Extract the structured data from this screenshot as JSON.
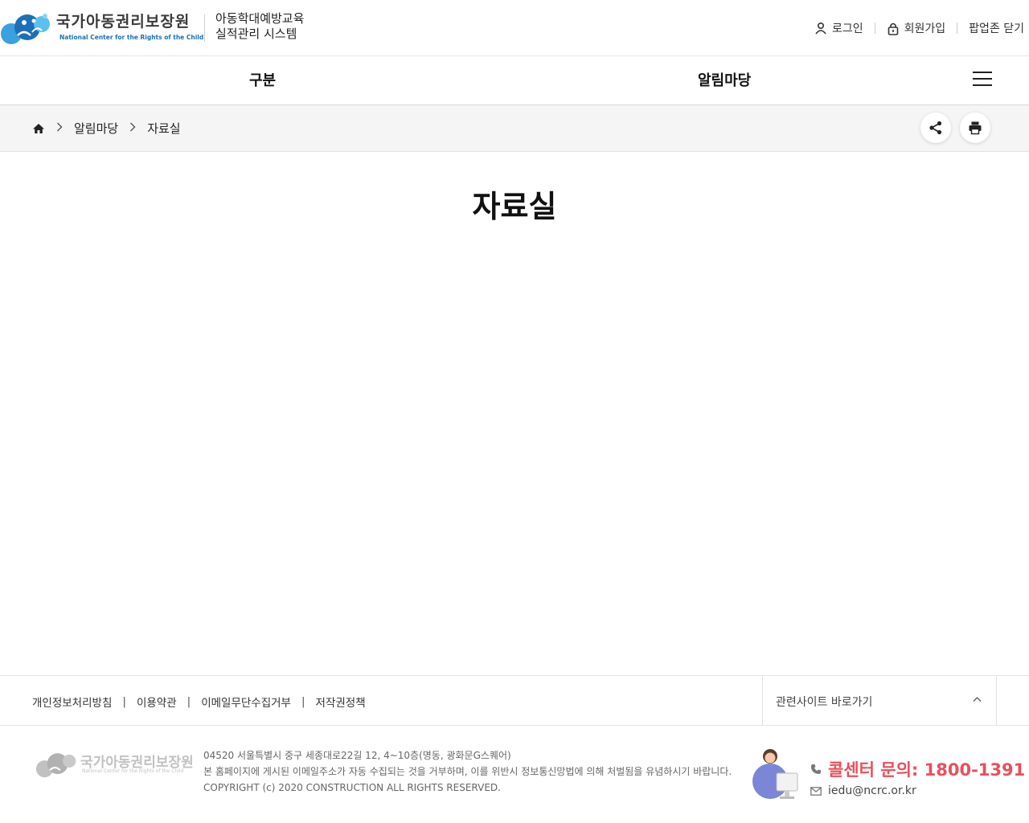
{
  "header": {
    "logo_ko": "국가아동권리보장원",
    "logo_en": "National Center for the Rights of the Child",
    "system_title_line1": "아동학대예방교육",
    "system_title_line2": "실적관리 시스템",
    "util": {
      "login": "로그인",
      "signup": "회원가입",
      "close_popup": "팝업존 닫기"
    }
  },
  "gnb": {
    "items": [
      "구분",
      "알림마당"
    ]
  },
  "breadcrumb": {
    "level1": "알림마당",
    "level2": "자료실"
  },
  "page": {
    "title": "자료실"
  },
  "footer": {
    "links": [
      "개인정보처리방침",
      "이용약관",
      "이메일무단수집거부",
      "저작권정책"
    ],
    "separator": "|",
    "related_sites": "관련사이트 바로가기",
    "logo_ko": "국가아동권리보장원",
    "logo_en": "National Center for the Rights of the Child",
    "address": "04520 서울특별시 중구 세종대로22길 12, 4~10층(명동, 광화문G스퀘어)",
    "notice": "본 홈페이지에 게시된 이메일주소가 자동 수집되는 것을 거부하며, 이를 위반시 정보통신망법에 의해 처벌됨을 유념하시기 바랍니다.",
    "copyright": "COPYRIGHT (c) 2020 CONSTRUCTION ALL RIGHTS RESERVED.",
    "callcenter": "콜센터 문의: 1800-1391",
    "email": "iedu@ncrc.or.kr"
  },
  "colors": {
    "accent_red": "#e8505b",
    "logo_blue": "#1d6fb8",
    "crumb_bg": "#f5f5f5"
  }
}
